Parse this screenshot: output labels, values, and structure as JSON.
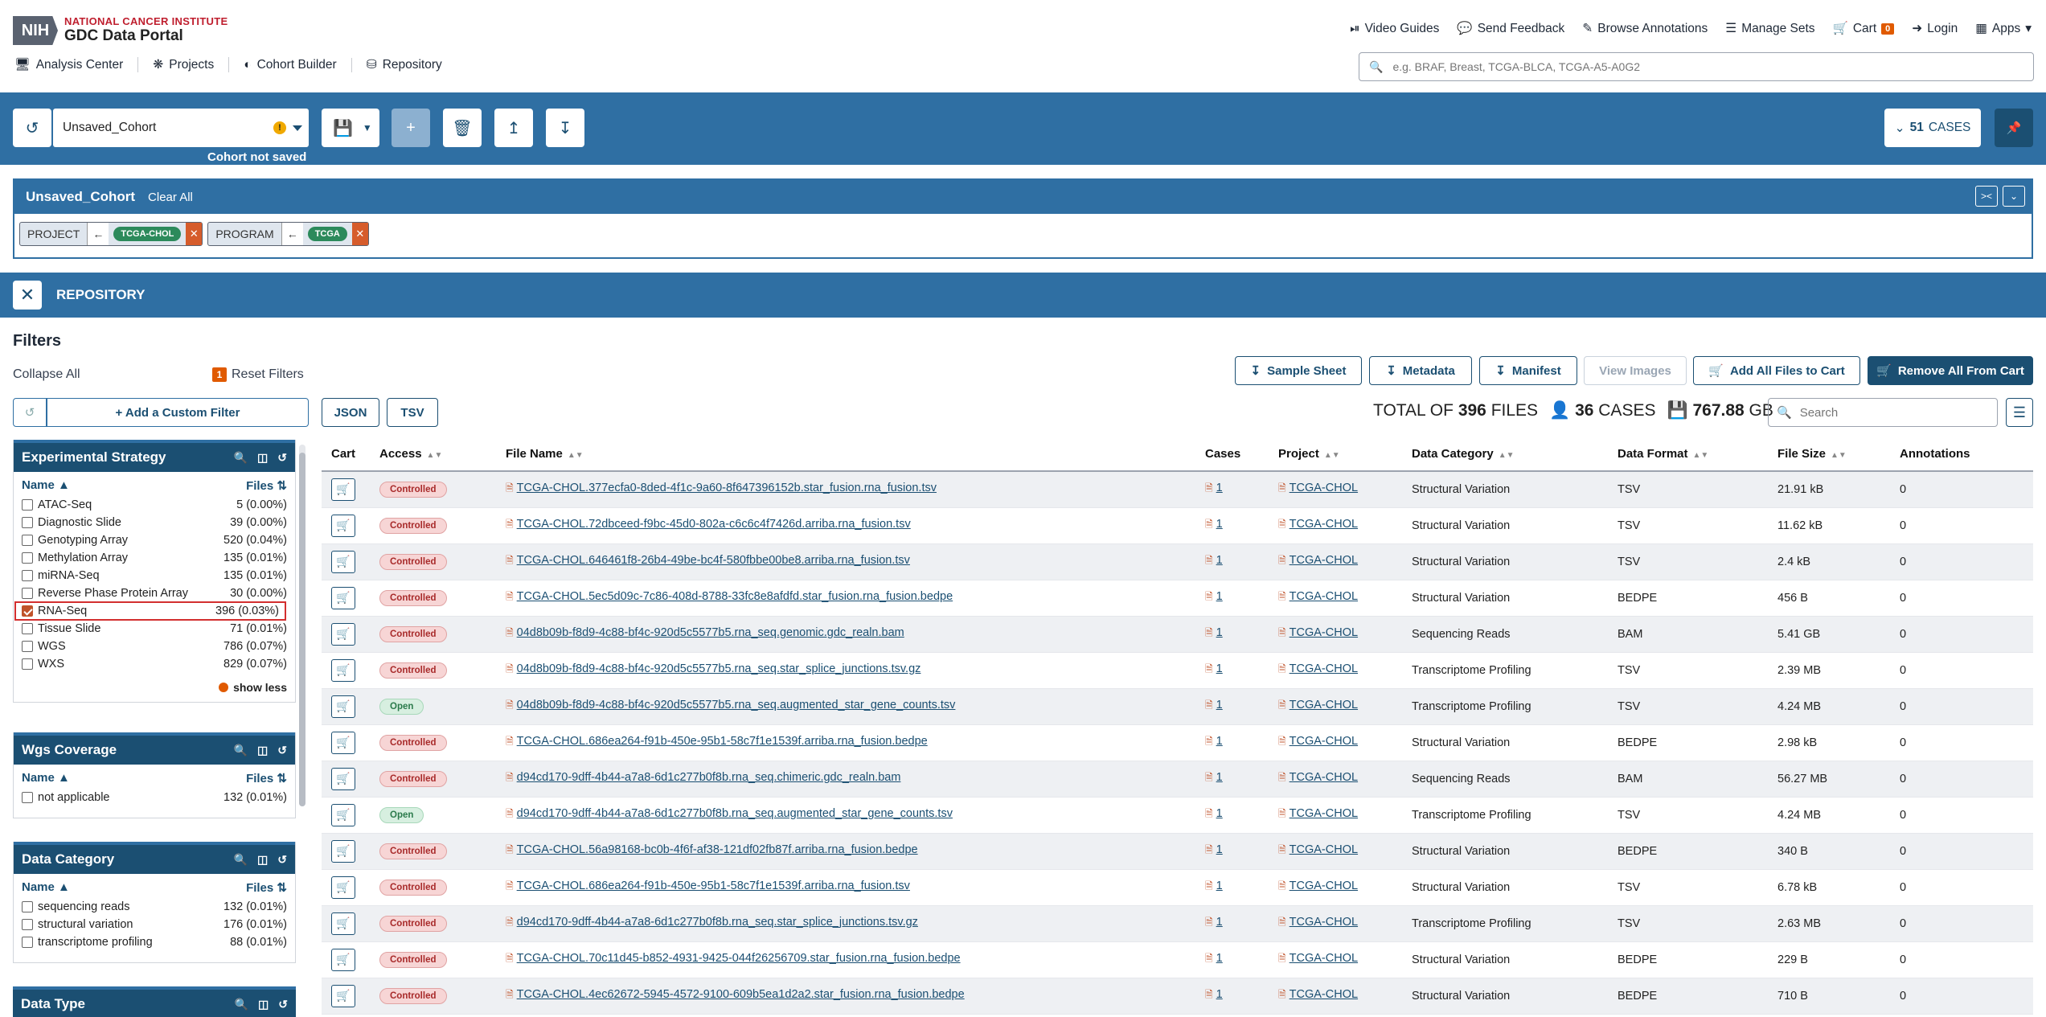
{
  "header": {
    "logo_nih": "NIH",
    "logo_nci": "NATIONAL CANCER INSTITUTE",
    "logo_gdc": "GDC Data Portal",
    "top_nav": [
      {
        "label": "Video Guides",
        "icon": "play-icon"
      },
      {
        "label": "Send Feedback",
        "icon": "feedback-icon"
      },
      {
        "label": "Browse Annotations",
        "icon": "edit-icon"
      },
      {
        "label": "Manage Sets",
        "icon": "sliders-icon"
      },
      {
        "label": "Cart",
        "icon": "cart-icon"
      },
      {
        "label": "Login",
        "icon": "login-icon"
      },
      {
        "label": "Apps",
        "icon": "apps-grid-icon"
      }
    ],
    "cart_count": "0",
    "sec_nav": [
      {
        "label": "Analysis Center",
        "icon": "analysis-icon"
      },
      {
        "label": "Projects",
        "icon": "projects-icon"
      },
      {
        "label": "Cohort Builder",
        "icon": "cohort-icon"
      },
      {
        "label": "Repository",
        "icon": "database-icon"
      }
    ],
    "search_placeholder": "e.g. BRAF, Breast, TCGA-BLCA, TCGA-A5-A0G2"
  },
  "cohort_bar": {
    "cohort_name": "Unsaved_Cohort",
    "status": "Cohort not saved",
    "cases_count": "51",
    "cases_label": "CASES"
  },
  "cohort_panel": {
    "title": "Unsaved_Cohort",
    "clear": "Clear All",
    "filters": [
      {
        "key": "PROJECT",
        "value": "TCGA-CHOL"
      },
      {
        "key": "PROGRAM",
        "value": "TCGA"
      }
    ]
  },
  "repository": {
    "title": "REPOSITORY"
  },
  "filters": {
    "title": "Filters",
    "collapse": "Collapse All",
    "reset_count": "1",
    "reset": "Reset Filters",
    "add_custom": "+ Add a Custom Filter",
    "name_col": "Name",
    "files_col": "Files",
    "show_less": "show less",
    "facets": [
      {
        "title": "Experimental Strategy",
        "items": [
          {
            "name": "ATAC-Seq",
            "count": "5 (0.00%)",
            "checked": false
          },
          {
            "name": "Diagnostic Slide",
            "count": "39 (0.00%)",
            "checked": false
          },
          {
            "name": "Genotyping Array",
            "count": "520 (0.04%)",
            "checked": false
          },
          {
            "name": "Methylation Array",
            "count": "135 (0.01%)",
            "checked": false
          },
          {
            "name": "miRNA-Seq",
            "count": "135 (0.01%)",
            "checked": false
          },
          {
            "name": "Reverse Phase Protein Array",
            "count": "30 (0.00%)",
            "checked": false
          },
          {
            "name": "RNA-Seq",
            "count": "396 (0.03%)",
            "checked": true
          },
          {
            "name": "Tissue Slide",
            "count": "71 (0.01%)",
            "checked": false
          },
          {
            "name": "WGS",
            "count": "786 (0.07%)",
            "checked": false
          },
          {
            "name": "WXS",
            "count": "829 (0.07%)",
            "checked": false
          }
        ]
      },
      {
        "title": "Wgs Coverage",
        "items": [
          {
            "name": "not applicable",
            "count": "132 (0.01%)",
            "checked": false
          }
        ]
      },
      {
        "title": "Data Category",
        "items": [
          {
            "name": "sequencing reads",
            "count": "132 (0.01%)",
            "checked": false
          },
          {
            "name": "structural variation",
            "count": "176 (0.01%)",
            "checked": false
          },
          {
            "name": "transcriptome profiling",
            "count": "88 (0.01%)",
            "checked": false
          }
        ]
      },
      {
        "title": "Data Type",
        "items": []
      }
    ]
  },
  "actions": {
    "sample_sheet": "Sample Sheet",
    "metadata": "Metadata",
    "manifest": "Manifest",
    "view_images": "View Images",
    "add_all": "Add All Files to Cart",
    "remove_all": "Remove All From Cart",
    "json": "JSON",
    "tsv": "TSV"
  },
  "totals": {
    "prefix": "TOTAL OF",
    "files": "396",
    "files_label": "FILES",
    "cases": "36",
    "cases_label": "CASES",
    "size": "767.88",
    "size_unit": "GB"
  },
  "table": {
    "search_placeholder": "Search",
    "columns": [
      "Cart",
      "Access",
      "File Name",
      "Cases",
      "Project",
      "Data Category",
      "Data Format",
      "File Size",
      "Annotations"
    ],
    "rows": [
      {
        "access": "Controlled",
        "file": "TCGA-CHOL.377ecfa0-8ded-4f1c-9a60-8f647396152b.star_fusion.rna_fusion.tsv",
        "cases": "1",
        "project": "TCGA-CHOL",
        "category": "Structural Variation",
        "format": "TSV",
        "size": "21.91 kB",
        "annotations": "0"
      },
      {
        "access": "Controlled",
        "file": "TCGA-CHOL.72dbceed-f9bc-45d0-802a-c6c6c4f7426d.arriba.rna_fusion.tsv",
        "cases": "1",
        "project": "TCGA-CHOL",
        "category": "Structural Variation",
        "format": "TSV",
        "size": "11.62 kB",
        "annotations": "0"
      },
      {
        "access": "Controlled",
        "file": "TCGA-CHOL.646461f8-26b4-49be-bc4f-580fbbe00be8.arriba.rna_fusion.tsv",
        "cases": "1",
        "project": "TCGA-CHOL",
        "category": "Structural Variation",
        "format": "TSV",
        "size": "2.4 kB",
        "annotations": "0"
      },
      {
        "access": "Controlled",
        "file": "TCGA-CHOL.5ec5d09c-7c86-408d-8788-33fc8e8afdfd.star_fusion.rna_fusion.bedpe",
        "cases": "1",
        "project": "TCGA-CHOL",
        "category": "Structural Variation",
        "format": "BEDPE",
        "size": "456 B",
        "annotations": "0"
      },
      {
        "access": "Controlled",
        "file": "04d8b09b-f8d9-4c88-bf4c-920d5c5577b5.rna_seq.genomic.gdc_realn.bam",
        "cases": "1",
        "project": "TCGA-CHOL",
        "category": "Sequencing Reads",
        "format": "BAM",
        "size": "5.41 GB",
        "annotations": "0"
      },
      {
        "access": "Controlled",
        "file": "04d8b09b-f8d9-4c88-bf4c-920d5c5577b5.rna_seq.star_splice_junctions.tsv.gz",
        "cases": "1",
        "project": "TCGA-CHOL",
        "category": "Transcriptome Profiling",
        "format": "TSV",
        "size": "2.39 MB",
        "annotations": "0"
      },
      {
        "access": "Open",
        "file": "04d8b09b-f8d9-4c88-bf4c-920d5c5577b5.rna_seq.augmented_star_gene_counts.tsv",
        "cases": "1",
        "project": "TCGA-CHOL",
        "category": "Transcriptome Profiling",
        "format": "TSV",
        "size": "4.24 MB",
        "annotations": "0"
      },
      {
        "access": "Controlled",
        "file": "TCGA-CHOL.686ea264-f91b-450e-95b1-58c7f1e1539f.arriba.rna_fusion.bedpe",
        "cases": "1",
        "project": "TCGA-CHOL",
        "category": "Structural Variation",
        "format": "BEDPE",
        "size": "2.98 kB",
        "annotations": "0"
      },
      {
        "access": "Controlled",
        "file": "d94cd170-9dff-4b44-a7a8-6d1c277b0f8b.rna_seq.chimeric.gdc_realn.bam",
        "cases": "1",
        "project": "TCGA-CHOL",
        "category": "Sequencing Reads",
        "format": "BAM",
        "size": "56.27 MB",
        "annotations": "0"
      },
      {
        "access": "Open",
        "file": "d94cd170-9dff-4b44-a7a8-6d1c277b0f8b.rna_seq.augmented_star_gene_counts.tsv",
        "cases": "1",
        "project": "TCGA-CHOL",
        "category": "Transcriptome Profiling",
        "format": "TSV",
        "size": "4.24 MB",
        "annotations": "0"
      },
      {
        "access": "Controlled",
        "file": "TCGA-CHOL.56a98168-bc0b-4f6f-af38-121df02fb87f.arriba.rna_fusion.bedpe",
        "cases": "1",
        "project": "TCGA-CHOL",
        "category": "Structural Variation",
        "format": "BEDPE",
        "size": "340 B",
        "annotations": "0"
      },
      {
        "access": "Controlled",
        "file": "TCGA-CHOL.686ea264-f91b-450e-95b1-58c7f1e1539f.arriba.rna_fusion.tsv",
        "cases": "1",
        "project": "TCGA-CHOL",
        "category": "Structural Variation",
        "format": "TSV",
        "size": "6.78 kB",
        "annotations": "0"
      },
      {
        "access": "Controlled",
        "file": "d94cd170-9dff-4b44-a7a8-6d1c277b0f8b.rna_seq.star_splice_junctions.tsv.gz",
        "cases": "1",
        "project": "TCGA-CHOL",
        "category": "Transcriptome Profiling",
        "format": "TSV",
        "size": "2.63 MB",
        "annotations": "0"
      },
      {
        "access": "Controlled",
        "file": "TCGA-CHOL.70c11d45-b852-4931-9425-044f26256709.star_fusion.rna_fusion.bedpe",
        "cases": "1",
        "project": "TCGA-CHOL",
        "category": "Structural Variation",
        "format": "BEDPE",
        "size": "229 B",
        "annotations": "0"
      },
      {
        "access": "Controlled",
        "file": "TCGA-CHOL.4ec62672-5945-4572-9100-609b5ea1d2a2.star_fusion.rna_fusion.bedpe",
        "cases": "1",
        "project": "TCGA-CHOL",
        "category": "Structural Variation",
        "format": "BEDPE",
        "size": "710 B",
        "annotations": "0"
      }
    ]
  },
  "colors": {
    "primary": "#1b4f72",
    "bar": "#2f6fa3",
    "accent": "#e05a00",
    "controlled": "#a82a2a",
    "open": "#2b7a4b"
  }
}
